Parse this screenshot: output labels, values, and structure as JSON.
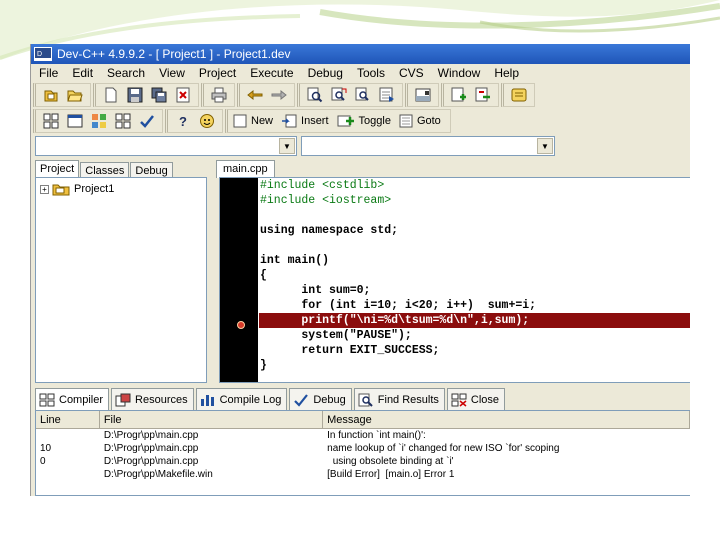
{
  "window": {
    "title": "Dev-C++ 4.9.9.2  - [ Project1 ] - Project1.dev"
  },
  "menu": [
    "File",
    "Edit",
    "Search",
    "View",
    "Project",
    "Execute",
    "Debug",
    "Tools",
    "CVS",
    "Window",
    "Help"
  ],
  "toolbar2": {
    "new_label": "New",
    "insert_label": "Insert",
    "toggle_label": "Toggle",
    "goto_label": "Goto"
  },
  "left_tabs": [
    "Project",
    "Classes",
    "Debug"
  ],
  "project_tree": {
    "root": "Project1"
  },
  "editor": {
    "tab": "main.cpp",
    "lines": [
      "#include <cstdlib>",
      "#include <iostream>",
      "",
      "using namespace std;",
      "",
      "int main()",
      "{",
      "      int sum=0;",
      "      for (int i=10; i<20; i++)  sum+=i;",
      "      printf(\"\\ni=%d\\tsum=%d\\n\",i,sum);",
      "      system(\"PAUSE\");",
      "      return EXIT_SUCCESS;",
      "}"
    ],
    "breakpoint_line": 10
  },
  "bottom_tabs": [
    "Compiler",
    "Resources",
    "Compile Log",
    "Debug",
    "Find Results",
    "Close"
  ],
  "compiler_log": {
    "headers": [
      "Line",
      "File",
      "Message"
    ],
    "rows": [
      [
        "",
        "D:\\Progr\\pp\\main.cpp",
        "In function `int main()':"
      ],
      [
        "10",
        "D:\\Progr\\pp\\main.cpp",
        "name lookup of `i' changed for new ISO `for' scoping"
      ],
      [
        "0",
        "D:\\Progr\\pp\\main.cpp",
        "  using obsolete binding at `i'"
      ],
      [
        "",
        "D:\\Progr\\pp\\Makefile.win",
        "[Build Error]  [main.o] Error 1"
      ]
    ]
  },
  "colors": {
    "breakpoint_line": "#8b0d0d",
    "gutter": "#000000",
    "title_bar": "#1f55b8",
    "keyword_string": "#0000c8",
    "number": "#e0261a",
    "preprocessor": "#0a7a14"
  }
}
